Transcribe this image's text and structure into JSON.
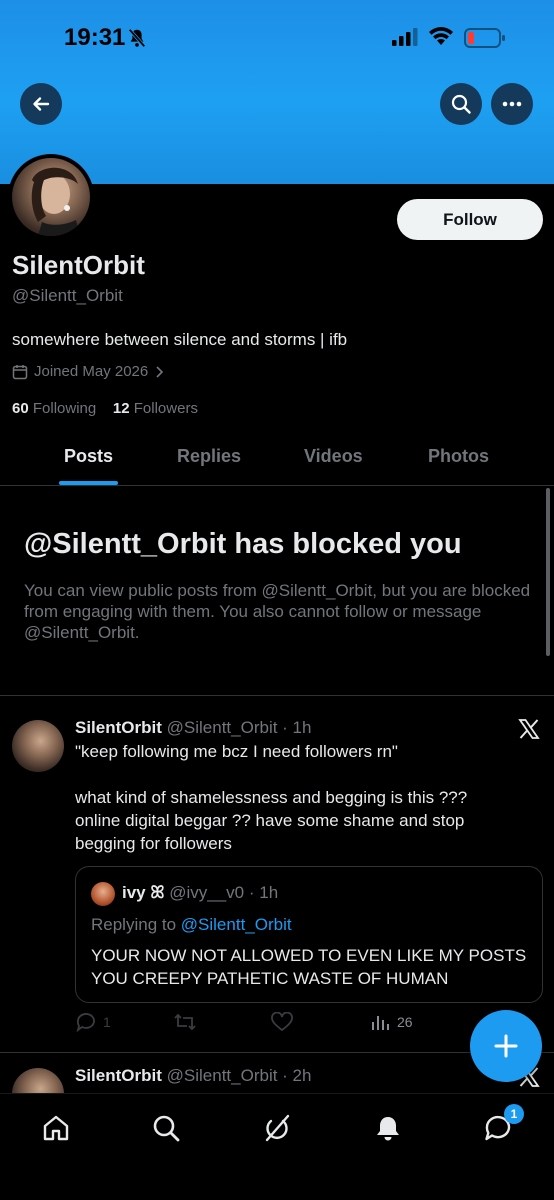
{
  "status_bar": {
    "time": "19:31"
  },
  "header": {
    "back_icon": "arrow-left-icon",
    "search_icon": "search-icon",
    "more_icon": "more-horizontal-icon"
  },
  "profile": {
    "display_name": "SilentOrbit",
    "handle": "@Silentt_Orbit",
    "bio": "somewhere between silence and storms | ifb",
    "joined": "Joined May 2026",
    "following_count": "60",
    "following_label": "Following",
    "followers_count": "12",
    "followers_label": "Followers",
    "follow_label": "Follow"
  },
  "tabs": [
    {
      "label": "Posts",
      "active": true
    },
    {
      "label": "Replies"
    },
    {
      "label": "Videos"
    },
    {
      "label": "Photos"
    }
  ],
  "blocked": {
    "title": "@Silentt_Orbit has blocked you",
    "text": "You can view public posts from @Silentt_Orbit, but you are blocked from engaging with them. You also cannot follow or message @Silentt_Orbit."
  },
  "posts": [
    {
      "name": "SilentOrbit",
      "meta": "@Silentt_Orbit · 1h",
      "line1": "\"keep following me bcz I need followers rn\"",
      "line2": "what kind of shamelessness and begging is this ??? online digital beggar ?? have some shame and stop begging for followers",
      "quote": {
        "name": "ivy ꕤ",
        "meta": "@ivy__v0 · 1h",
        "replying_prefix": "Replying to ",
        "replying_to": "@Silentt_Orbit",
        "text": "YOUR NOW NOT ALLOWED TO EVEN LIKE MY POSTS YOU CREEPY PATHETIC WASTE OF HUMAN"
      },
      "stats": {
        "replies": "1",
        "views": "26"
      }
    },
    {
      "name": "SilentOrbit",
      "meta": "@Silentt_Orbit · 2h"
    }
  ],
  "bottom_nav": {
    "messages_badge": "1"
  },
  "colors": {
    "accent": "#1d9bf0",
    "banner": "#1ea0f2",
    "background": "#000000",
    "muted": "#71767b"
  }
}
